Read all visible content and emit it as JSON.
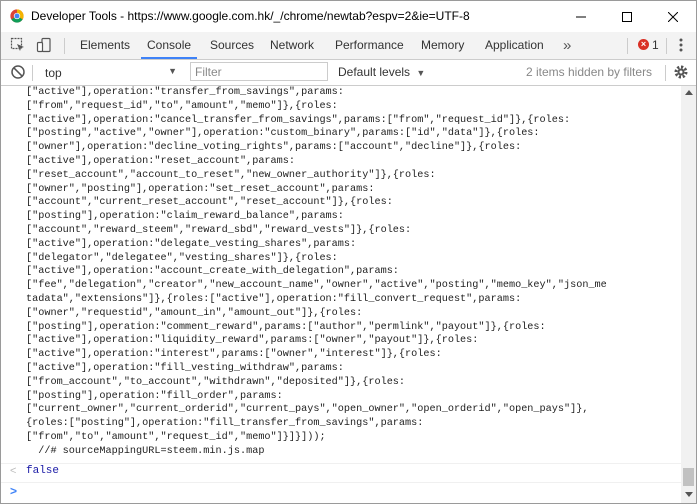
{
  "window": {
    "title": "Developer Tools - https://www.google.com.hk/_/chrome/newtab?espv=2&ie=UTF-8"
  },
  "tabs": [
    {
      "label": "Elements"
    },
    {
      "label": "Console"
    },
    {
      "label": "Sources"
    },
    {
      "label": "Network"
    },
    {
      "label": "Performance"
    },
    {
      "label": "Memory"
    },
    {
      "label": "Application"
    }
  ],
  "more_tabs": "»",
  "errors": {
    "count": "1"
  },
  "filterbar": {
    "context": "top",
    "filter_placeholder": "Filter",
    "levels": "Default levels",
    "hidden_note": "2 items hidden by filters"
  },
  "console": {
    "lines": [
      "[\"active\"],operation:\"transfer_from_savings\",params:",
      "[\"from\",\"request_id\",\"to\",\"amount\",\"memo\"]},{roles:",
      "[\"active\"],operation:\"cancel_transfer_from_savings\",params:[\"from\",\"request_id\"]},{roles:",
      "[\"posting\",\"active\",\"owner\"],operation:\"custom_binary\",params:[\"id\",\"data\"]},{roles:",
      "[\"owner\"],operation:\"decline_voting_rights\",params:[\"account\",\"decline\"]},{roles:",
      "[\"active\"],operation:\"reset_account\",params:",
      "[\"reset_account\",\"account_to_reset\",\"new_owner_authority\"]},{roles:",
      "[\"owner\",\"posting\"],operation:\"set_reset_account\",params:",
      "[\"account\",\"current_reset_account\",\"reset_account\"]},{roles:",
      "[\"posting\"],operation:\"claim_reward_balance\",params:",
      "[\"account\",\"reward_steem\",\"reward_sbd\",\"reward_vests\"]},{roles:",
      "[\"active\"],operation:\"delegate_vesting_shares\",params:",
      "[\"delegator\",\"delegatee\",\"vesting_shares\"]},{roles:",
      "[\"active\"],operation:\"account_create_with_delegation\",params:",
      "[\"fee\",\"delegation\",\"creator\",\"new_account_name\",\"owner\",\"active\",\"posting\",\"memo_key\",\"json_me",
      "tadata\",\"extensions\"]},{roles:[\"active\"],operation:\"fill_convert_request\",params:",
      "[\"owner\",\"requestid\",\"amount_in\",\"amount_out\"]},{roles:",
      "[\"posting\"],operation:\"comment_reward\",params:[\"author\",\"permlink\",\"payout\"]},{roles:",
      "[\"active\"],operation:\"liquidity_reward\",params:[\"owner\",\"payout\"]},{roles:",
      "[\"active\"],operation:\"interest\",params:[\"owner\",\"interest\"]},{roles:",
      "[\"active\"],operation:\"fill_vesting_withdraw\",params:",
      "[\"from_account\",\"to_account\",\"withdrawn\",\"deposited\"]},{roles:",
      "[\"posting\"],operation:\"fill_order\",params:",
      "[\"current_owner\",\"current_orderid\",\"current_pays\",\"open_owner\",\"open_orderid\",\"open_pays\"]},",
      "{roles:[\"posting\"],operation:\"fill_transfer_from_savings\",params:",
      "[\"from\",\"to\",\"amount\",\"request_id\",\"memo\"]}]}]));",
      "  //# sourceMappingURL=steem.min.js.map"
    ],
    "result_arrow": "<",
    "result_value": "false",
    "prompt": ">"
  },
  "colors": {
    "accent": "#3e82f7",
    "error": "#d93025",
    "result_value": "#1a1aa6"
  }
}
